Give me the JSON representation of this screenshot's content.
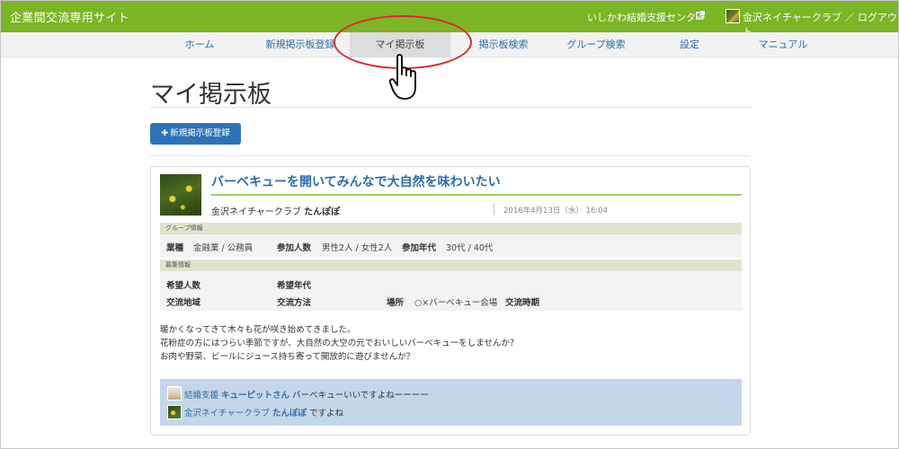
{
  "header": {
    "site_title": "企業間交流専用サイト",
    "center_link": "いしかわ結婚支援センター",
    "user_link": "金沢ネイチャークラブ ／ ログアウト"
  },
  "nav": {
    "items": [
      {
        "label": "ホーム"
      },
      {
        "label": "新規掲示板登録"
      },
      {
        "label": "マイ掲示板",
        "active": true
      },
      {
        "label": "掲示板検索"
      },
      {
        "label": "グループ検索"
      },
      {
        "label": "設定"
      },
      {
        "label": "マニュアル"
      }
    ]
  },
  "page": {
    "title": "マイ掲示板",
    "new_button": "新規掲示板登録"
  },
  "post": {
    "title": "バーベキューを開いてみんなで大自然を味わいたい",
    "org": "金沢ネイチャークラブ",
    "nickname": "たんぽぽ",
    "date": "2016年4月13日（水） 16:04",
    "group_info": {
      "heading": "グループ情報",
      "industry_label": "業種",
      "industry_value": "金融業 / 公務員",
      "count_label": "参加人数",
      "count_value": "男性2人 / 女性2人",
      "age_label": "参加年代",
      "age_value": "30代 / 40代"
    },
    "recruit_info": {
      "heading": "募集情報",
      "want_count_label": "希望人数",
      "want_age_label": "希望年代",
      "area_label": "交流地域",
      "method_label": "交流方法",
      "place_label": "場所",
      "place_value": "○×バーベキュー会場",
      "time_label": "交流時期"
    },
    "description": [
      "暖かくなってきて木々も花が咲き始めてきました。",
      "花粉症の方にはつらい季節ですが、大自然の大空の元でおいしいバーベキューをしませんか？",
      "お肉や野菜、ビールにジュース持ち寄って開放的に遊びませんか？"
    ],
    "comments": [
      {
        "role": "結婚支援",
        "name": "キューピットさん",
        "text": "バーベキューいいですよねーーーー"
      },
      {
        "role": "金沢ネイチャークラブ",
        "name": "たんぽぽ",
        "text": "ですよね"
      }
    ]
  },
  "colors": {
    "topbar": "#7cb526",
    "link": "#2c6cab",
    "button": "#2d72b8",
    "annotation_ring": "#d92b2b"
  },
  "icons": [
    "external-link-icon",
    "user-avatar",
    "plus-icon",
    "hand-cursor-icon"
  ]
}
